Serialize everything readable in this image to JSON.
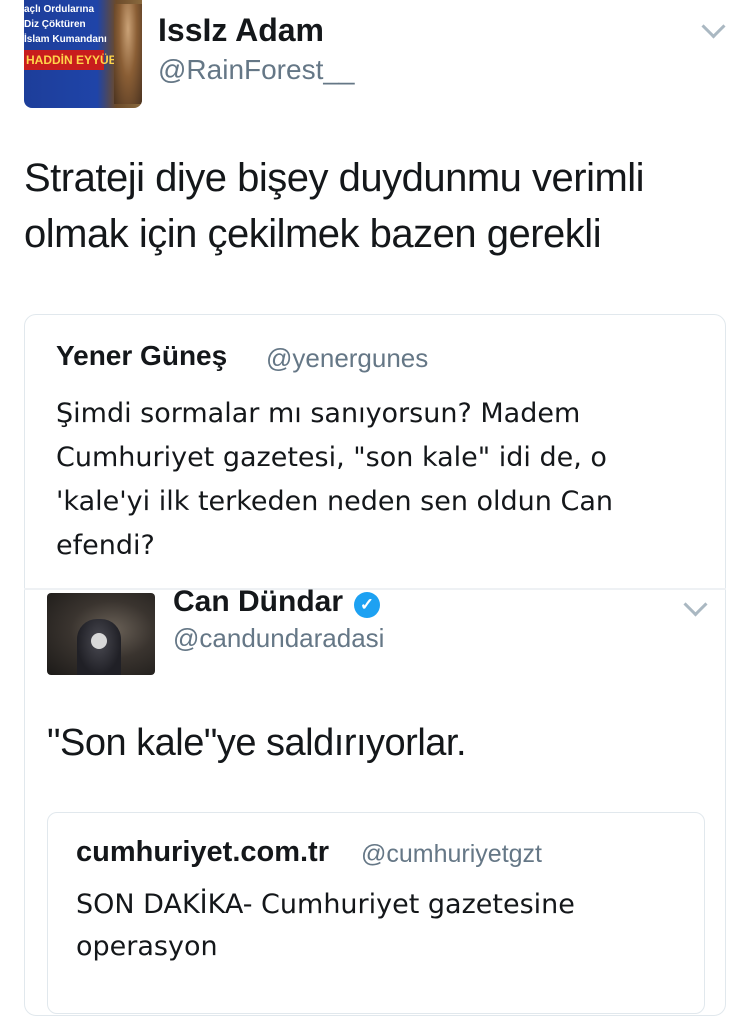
{
  "tweet": {
    "avatar_lines": [
      "açlı Ordularına",
      "Diz Çöktüren",
      "İslam Kumandanı"
    ],
    "avatar_banner": "HADDİN EYYÜBİ",
    "author_name": "IssIz Adam",
    "author_handle": "@RainForest__",
    "text": "Strateji diye bişey duydunmu verimli olmak için çekilmek bazen gerekli"
  },
  "quoted_tweet": {
    "author_name": "Yener Güneş",
    "author_handle": "@yenergunes",
    "text": "Şimdi sormalar mı sanıyorsun? Madem Cumhuriyet gazetesi, \"son kale\" idi de, o 'kale'yi ilk terkeden neden sen oldun Can efendi?"
  },
  "embedded_tweet": {
    "author_name": "Can Dündar",
    "verified_icon": "✓",
    "author_handle": "@candundaradasi",
    "text": "\"Son kale\"ye saldırıyorlar.",
    "quote": {
      "author_name": "cumhuriyet.com.tr",
      "author_handle": "@cumhuriyetgzt",
      "text": "SON DAKİKA- Cumhuriyet gazetesine operasyon"
    }
  },
  "colors": {
    "text": "#14171a",
    "secondary": "#657786",
    "border": "#e1e8ed",
    "verified": "#1da1f2"
  },
  "icons": [
    "chevron-down-icon",
    "verified-badge-icon"
  ]
}
